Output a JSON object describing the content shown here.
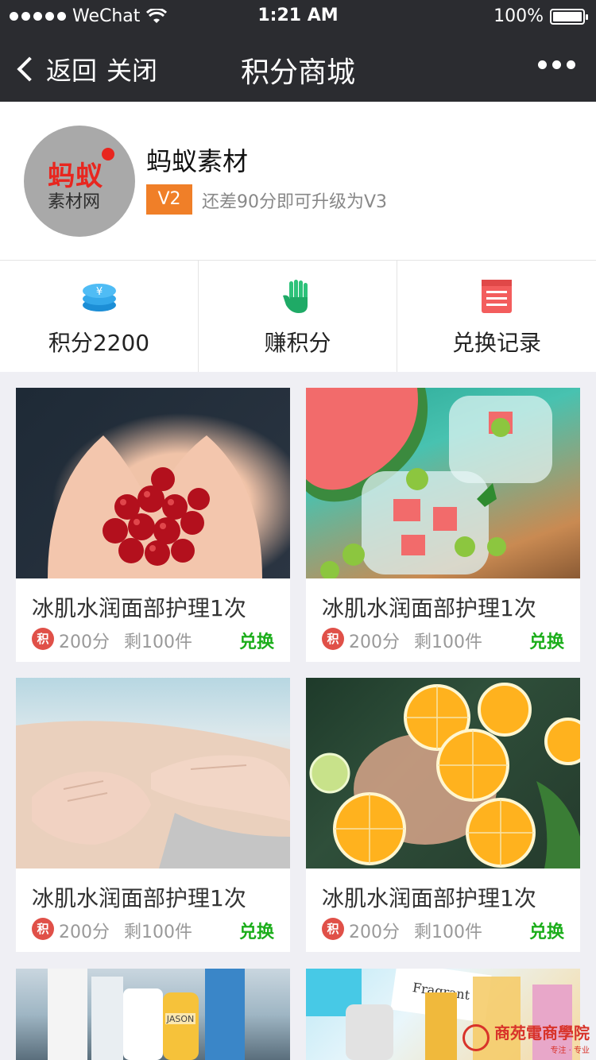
{
  "status_bar": {
    "carrier": "WeChat",
    "time": "1:21 AM",
    "battery": "100%",
    "battery_level": 1.0
  },
  "nav": {
    "back_label": "返回",
    "close_label": "关闭",
    "title": "积分商城"
  },
  "profile": {
    "avatar_text_1": "蚂蚁",
    "avatar_text_2": "素材网",
    "name": "蚂蚁素材",
    "level": "V2",
    "hint": "还差90分即可升级为V3"
  },
  "stats": [
    {
      "label": "积分2200",
      "icon": "coin-stack-icon"
    },
    {
      "label": "赚积分",
      "icon": "hand-icon"
    },
    {
      "label": "兑换记录",
      "icon": "record-list-icon"
    }
  ],
  "products": [
    {
      "title": "冰肌水润面部护理1次",
      "badge": "积",
      "points": "200分",
      "stock": "剩100件",
      "action": "兑换"
    },
    {
      "title": "冰肌水润面部护理1次",
      "badge": "积",
      "points": "200分",
      "stock": "剩100件",
      "action": "兑换"
    },
    {
      "title": "冰肌水润面部护理1次",
      "badge": "积",
      "points": "200分",
      "stock": "剩100件",
      "action": "兑换"
    },
    {
      "title": "冰肌水润面部护理1次",
      "badge": "积",
      "points": "200分",
      "stock": "剩100件",
      "action": "兑换"
    }
  ],
  "image_text": {
    "bottle_label": "JASON",
    "perfume_label": "Fragrant"
  },
  "watermark": {
    "text": "商苑電商學院",
    "sub": "专注 · 专业"
  },
  "colors": {
    "nav_bg": "#2b2c30",
    "level_badge": "#f07f28",
    "exchange": "#1aad19",
    "points_badge": "#e05048"
  }
}
